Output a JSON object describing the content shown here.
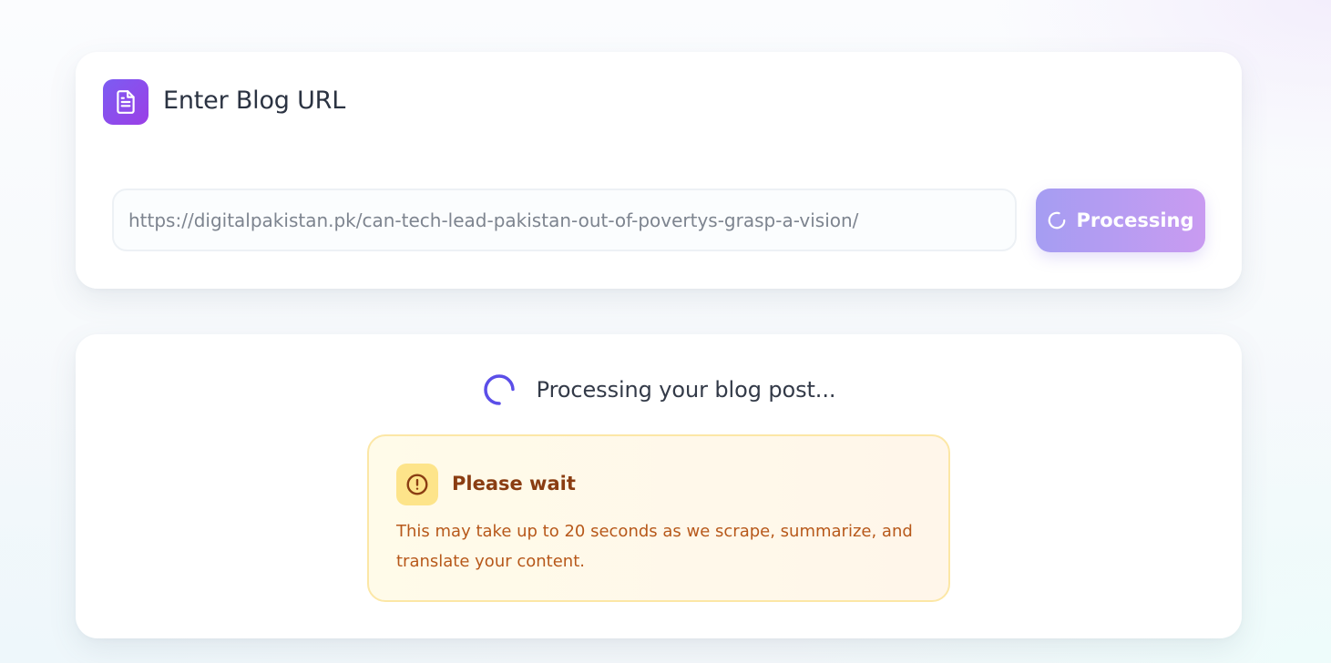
{
  "input_card": {
    "icon": "document-icon",
    "title": "Enter Blog URL",
    "url_input": {
      "value": "https://digitalpakistan.pk/can-tech-lead-pakistan-out-of-povertys-grasp-a-vision/",
      "placeholder": ""
    },
    "process_button": {
      "icon": "spinner-icon",
      "label": "Processing"
    }
  },
  "status_card": {
    "spinner_icon": "spinner-icon",
    "status_text": "Processing your blog post...",
    "notice": {
      "icon": "alert-circle-icon",
      "title": "Please wait",
      "message": "This may take up to 20 seconds as we scrape, summarize, and translate your content."
    }
  },
  "colors": {
    "accent_gradient_start": "#7c5cf2",
    "accent_gradient_end": "#9b3fe6",
    "button_gradient_start": "#a59df2",
    "button_gradient_end": "#c99bf1",
    "spinner": "#5b4ee8",
    "notice_background": "#fffbe9",
    "notice_border": "#fce7a6",
    "notice_title": "#8a3d12",
    "notice_text": "#b7581a"
  }
}
